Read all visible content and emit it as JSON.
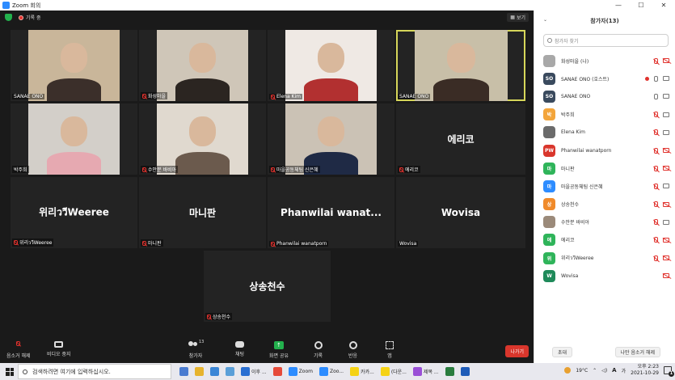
{
  "window": {
    "title": "Zoom 회의",
    "minimize": "—",
    "maximize": "☐",
    "close": "✕"
  },
  "meeting": {
    "recording_label": "기록 중",
    "view_button": "보기"
  },
  "tiles": [
    {
      "name": "SANAE ONO",
      "bg": "#c9b69a",
      "person": "#3b2f2a",
      "muted": false
    },
    {
      "name": "화성마을",
      "bg": "#cfc6b8",
      "person": "#2b2521",
      "muted": true
    },
    {
      "name": "Elena Kim",
      "bg": "#efe9e4",
      "person": "#b23030",
      "muted": true
    },
    {
      "name": "SANAE ONO",
      "bg": "#c8bfa8",
      "person": "#3a2c25",
      "muted": false,
      "active": true
    },
    {
      "name": "박주희",
      "bg": "#d3cfc9",
      "person": "#e6a9b1",
      "muted": false
    },
    {
      "name": "수안분 바비아",
      "bg": "#e0d9cf",
      "person": "#6b5a4d",
      "muted": true
    },
    {
      "name": "마을공동체팀 신은혜",
      "bg": "#cbc2b5",
      "person": "#1f2a45",
      "muted": true
    },
    {
      "name": "에리코",
      "big": "에리코",
      "muted": true
    },
    {
      "name": "위리ววีWeeree",
      "big": "위리ววีWeeree",
      "muted": true
    },
    {
      "name": "마니판",
      "big": "마니판",
      "muted": true
    },
    {
      "name": "Phanwilai wanatporn",
      "big": "Phanwilai  wanat...",
      "muted": true
    },
    {
      "name": "Wovisa",
      "big": "Wovisa",
      "muted": false
    },
    {
      "name": "상송천수",
      "big": "상송천수",
      "muted": true
    }
  ],
  "toolbar": {
    "audio": "음소거 해제",
    "video": "비디오 중지",
    "participants": "참가자",
    "participants_count": "13",
    "chat": "채팅",
    "share": "화면 공유",
    "record": "기록",
    "reactions": "반응",
    "apps": "앱",
    "leave": "나가기"
  },
  "panel": {
    "title": "참가자(13)",
    "search_placeholder": "참가자 찾기",
    "invite": "초대",
    "unmute_me": "나만 음소거 해제",
    "participants": [
      {
        "name": "화성마을 (나)",
        "avatar": "",
        "color": "#a8a8a8",
        "mic": "off",
        "cam": "off",
        "rec": false
      },
      {
        "name": "SANAE ONO (호스트)",
        "avatar": "SO",
        "color": "#3a4a5e",
        "mic": "on",
        "cam": "on",
        "rec": true
      },
      {
        "name": "SANAE ONO",
        "avatar": "SO",
        "color": "#3a4a5e",
        "mic": "on",
        "cam": "on",
        "rec": false
      },
      {
        "name": "박주희",
        "avatar": "박",
        "color": "#f3a53b",
        "mic": "off",
        "cam": "on",
        "rec": false
      },
      {
        "name": "Elena Kim",
        "avatar": "",
        "color": "#6b6b6b",
        "mic": "off",
        "cam": "on",
        "rec": false
      },
      {
        "name": "Phanwilai wanatporn",
        "avatar": "PW",
        "color": "#d9362c",
        "mic": "off",
        "cam": "off",
        "rec": false
      },
      {
        "name": "마니판",
        "avatar": "마",
        "color": "#2fb45a",
        "mic": "off",
        "cam": "off",
        "rec": false
      },
      {
        "name": "마을공동체팀 신은혜",
        "avatar": "마",
        "color": "#2d8cff",
        "mic": "off",
        "cam": "on",
        "rec": false
      },
      {
        "name": "상송천수",
        "avatar": "상",
        "color": "#f08a2a",
        "mic": "off",
        "cam": "off",
        "rec": false
      },
      {
        "name": "수안분 바비아",
        "avatar": "",
        "color": "#9b8a7a",
        "mic": "off",
        "cam": "on",
        "rec": false
      },
      {
        "name": "에리코",
        "avatar": "에",
        "color": "#2fb45a",
        "mic": "off",
        "cam": "off",
        "rec": false
      },
      {
        "name": "위리ววีWeeree",
        "avatar": "위",
        "color": "#2fb45a",
        "mic": "off",
        "cam": "off",
        "rec": false
      },
      {
        "name": "Wovisa",
        "avatar": "W",
        "color": "#1f8a5a",
        "mic": "none",
        "cam": "off",
        "rec": false
      }
    ]
  },
  "taskbar": {
    "search_placeholder": "검색하려면 여기에 입력하십시오.",
    "apps": [
      {
        "label": "",
        "color": "#4a7bd0"
      },
      {
        "label": "",
        "color": "#e6b32e"
      },
      {
        "label": "",
        "color": "#3b86d6"
      },
      {
        "label": "",
        "color": "#5a9fd8"
      },
      {
        "label": "이후 ...",
        "color": "#2a6fd2"
      },
      {
        "label": "",
        "color": "#e64a3a"
      },
      {
        "label": "Zoom",
        "color": "#2d8cff"
      },
      {
        "label": "Zoo...",
        "color": "#2d8cff"
      },
      {
        "label": "카카...",
        "color": "#f5d215"
      },
      {
        "label": "(다운...",
        "color": "#f5d215"
      },
      {
        "label": "제목 ...",
        "color": "#9a4fd6"
      },
      {
        "label": "",
        "color": "#2a7c3e"
      },
      {
        "label": "",
        "color": "#1e5bb8"
      }
    ],
    "weather": "19°C",
    "ime": "A",
    "lang": "가",
    "time": "오후 2:23",
    "date": "2021-10-29",
    "notif_count": "1"
  }
}
